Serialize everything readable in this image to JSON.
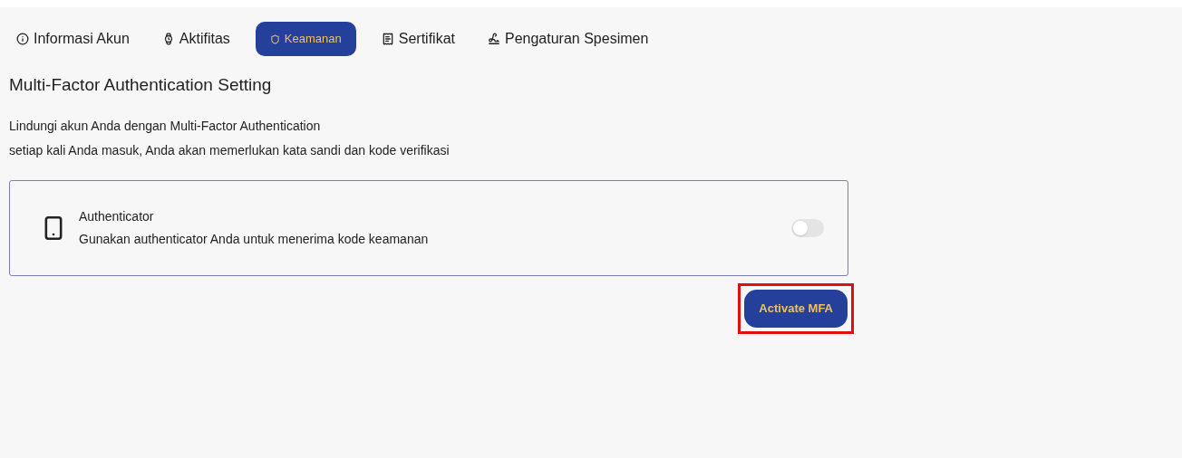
{
  "tabs": [
    {
      "label": "Informasi Akun",
      "kind": "info",
      "selected": false
    },
    {
      "label": "Aktifitas",
      "kind": "watch",
      "selected": false
    },
    {
      "label": "Keamanan",
      "kind": "shield",
      "selected": true
    },
    {
      "label": "Sertifikat",
      "kind": "certificate",
      "selected": false
    },
    {
      "label": "Pengaturan Spesimen",
      "kind": "signature",
      "selected": false
    }
  ],
  "section": {
    "title": "Multi-Factor Authentication Setting",
    "description": [
      "Lindungi akun Anda dengan Multi-Factor Authentication",
      "setiap kali Anda masuk, Anda akan memerlukan kata sandi dan kode verifikasi"
    ]
  },
  "methods": [
    {
      "title": "Authenticator",
      "subtitle": "Gunakan authenticator Anda untuk menerima kode keamanan",
      "on": false
    }
  ],
  "action_button": {
    "label": "Activate MFA",
    "highlighted": true
  }
}
